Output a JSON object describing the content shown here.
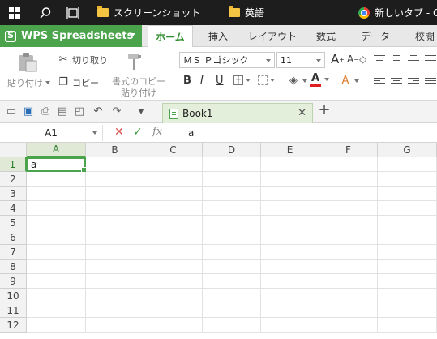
{
  "taskbar": {
    "items": [
      {
        "label": "スクリーンショット",
        "icon": "folder-icon"
      },
      {
        "label": "英語",
        "icon": "folder-icon"
      },
      {
        "label": "新しいタブ - Goo",
        "icon": "chrome-icon"
      }
    ]
  },
  "app": {
    "menu_button": "WPS Spreadsheets",
    "tabs": [
      "ホーム",
      "挿入",
      "レイアウト",
      "数式",
      "データ",
      "校閲"
    ],
    "active_tab": "ホーム",
    "accent_color": "#4ba34b"
  },
  "ribbon": {
    "paste_label": "貼り付け",
    "cut_label": "切り取り",
    "copy_label": "コピー",
    "format_copy_label_line1": "書式のコピー",
    "format_copy_label_line2": "貼り付け",
    "font_name": "ＭＳ Ｐゴシック",
    "font_size": "11",
    "bold": "B",
    "italic": "I",
    "underline": "U"
  },
  "document": {
    "tab_name": "Book1"
  },
  "formula_bar": {
    "name_box": "A1",
    "fx_label": "fx",
    "content": "a"
  },
  "sheet": {
    "columns": [
      "A",
      "B",
      "C",
      "D",
      "E",
      "F",
      "G"
    ],
    "rows": [
      "1",
      "2",
      "3",
      "4",
      "5",
      "6",
      "7",
      "8",
      "9",
      "10",
      "11",
      "12"
    ],
    "selected_cell": "A1",
    "cells": {
      "A1": "a"
    }
  }
}
